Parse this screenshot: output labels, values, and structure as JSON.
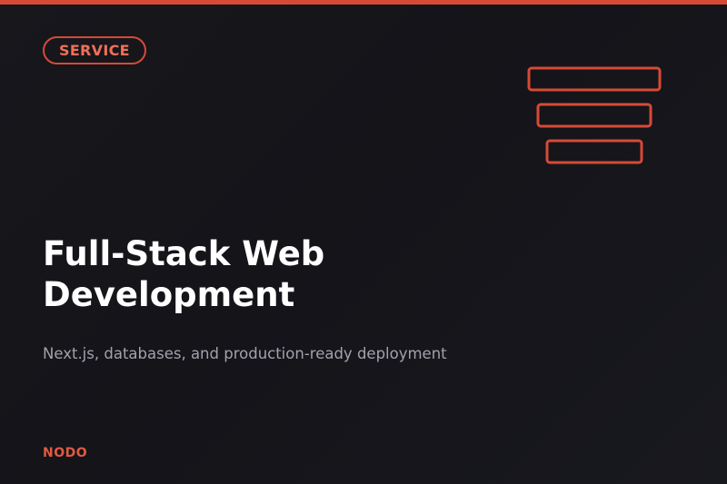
{
  "badge": {
    "label": "SERVICE"
  },
  "hero": {
    "title": "Full-Stack Web Development",
    "subtitle": "Next.js, databases, and production-ready deployment"
  },
  "footer": {
    "brand": "NODO"
  },
  "icons": {
    "stack": "stacked-layers-icon"
  },
  "colors": {
    "accent": "#d64a36",
    "background": "#16161b",
    "title": "#ffffff",
    "subtitle": "#a2a2ad"
  }
}
